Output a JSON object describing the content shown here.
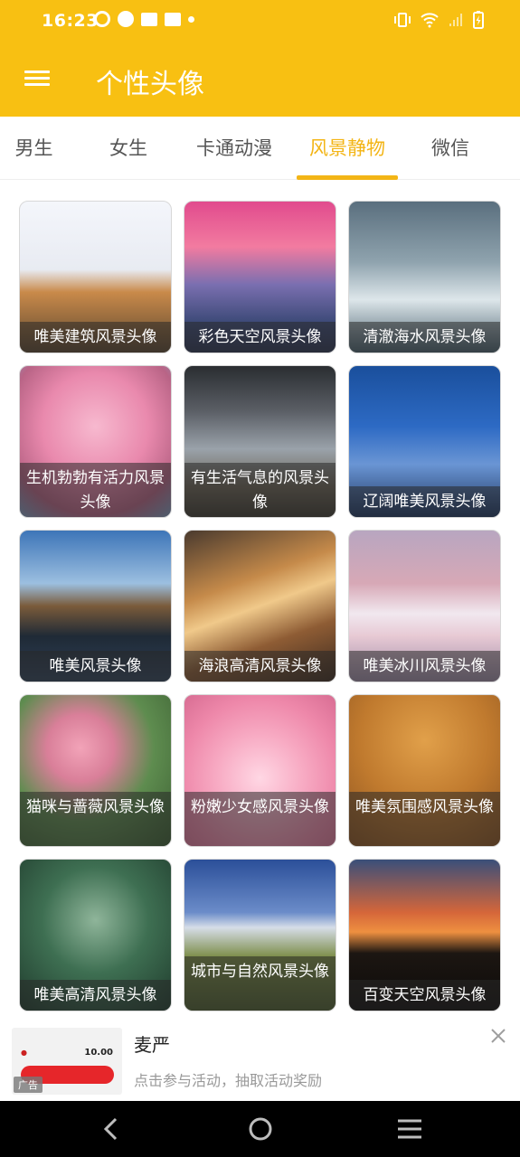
{
  "status_bar": {
    "time": "16:23"
  },
  "app_bar": {
    "title": "个性头像"
  },
  "tabs": [
    {
      "label": "男生"
    },
    {
      "label": "女生"
    },
    {
      "label": "卡通动漫"
    },
    {
      "label": "风景静物"
    },
    {
      "label": "微信"
    }
  ],
  "active_tab": "风景静物",
  "grid": [
    {
      "caption": "唯美建筑风景头像"
    },
    {
      "caption": "彩色天空风景头像"
    },
    {
      "caption": "清澈海水风景头像"
    },
    {
      "caption": "生机勃勃有活力风景头像"
    },
    {
      "caption": "有生活气息的风景头像"
    },
    {
      "caption": "辽阔唯美风景头像"
    },
    {
      "caption": "唯美风景头像"
    },
    {
      "caption": "海浪高清风景头像"
    },
    {
      "caption": "唯美冰川风景头像"
    },
    {
      "caption": "猫咪与蔷薇风景头像"
    },
    {
      "caption": "粉嫩少女感风景头像"
    },
    {
      "caption": "唯美氛围感风景头像"
    },
    {
      "caption": "唯美高清风景头像"
    },
    {
      "caption": "城市与自然风景头像"
    },
    {
      "caption": "百变天空风景头像"
    }
  ],
  "ad": {
    "title": "麦严",
    "description": "点击参与活动，抽取活动奖励",
    "label": "广告",
    "thumb_price": "10.00"
  },
  "colors": {
    "primary": "#f8c012",
    "accent": "#f3b516",
    "nav": "#000000"
  },
  "icons": {
    "menu": "hamburger-icon",
    "close": "close-icon",
    "back": "back-icon",
    "home": "home-icon",
    "recents": "recents-icon"
  }
}
